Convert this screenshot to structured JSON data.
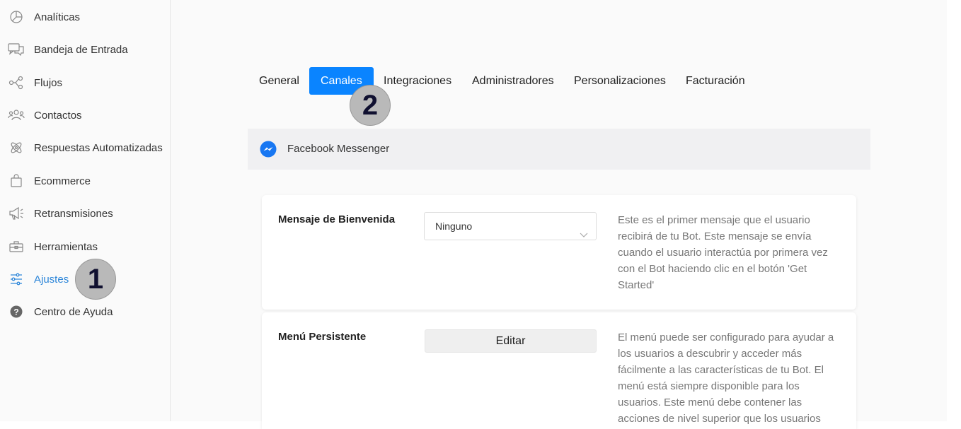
{
  "sidebar": {
    "items": [
      {
        "label": "Analíticas",
        "icon": "analytics-icon"
      },
      {
        "label": "Bandeja de Entrada",
        "icon": "inbox-icon"
      },
      {
        "label": "Flujos",
        "icon": "flows-icon"
      },
      {
        "label": "Contactos",
        "icon": "contacts-icon"
      },
      {
        "label": "Respuestas Automatizadas",
        "icon": "automated-responses-icon"
      },
      {
        "label": "Ecommerce",
        "icon": "shopping-bag-icon"
      },
      {
        "label": "Retransmisiones",
        "icon": "megaphone-icon"
      },
      {
        "label": "Herramientas",
        "icon": "toolbox-icon"
      },
      {
        "label": "Ajustes",
        "icon": "sliders-icon",
        "active": true
      },
      {
        "label": "Centro de Ayuda",
        "icon": "help-icon"
      }
    ]
  },
  "tabs": [
    {
      "label": "General"
    },
    {
      "label": "Canales",
      "active": true
    },
    {
      "label": "Integraciones"
    },
    {
      "label": "Administradores"
    },
    {
      "label": "Personalizaciones"
    },
    {
      "label": "Facturación"
    }
  ],
  "annotations": {
    "step1": "1",
    "step2": "2"
  },
  "channel": {
    "label": "Facebook Messenger",
    "icon": "messenger-icon",
    "icon_color": "#1877f2"
  },
  "welcome": {
    "title": "Mensaje de Bienvenida",
    "select_value": "Ninguno",
    "description": "Este es el primer mensaje que el usuario recibirá de tu Bot. Este mensaje se envía cuando el usuario interactúa por primera vez con el Bot haciendo clic en el botón 'Get Started'"
  },
  "persistent_menu": {
    "title": "Menú Persistente",
    "button_label": "Editar",
    "description": "El menú puede ser configurado para ayudar a los usuarios a descubrir y acceder más fácilmente a las características de tu Bot. El menú está siempre disponible para los usuarios. Este menú debe contener las acciones de nivel superior que los usuarios"
  },
  "colors": {
    "accent": "#0a84ff",
    "active_nav": "#2d86d9"
  }
}
